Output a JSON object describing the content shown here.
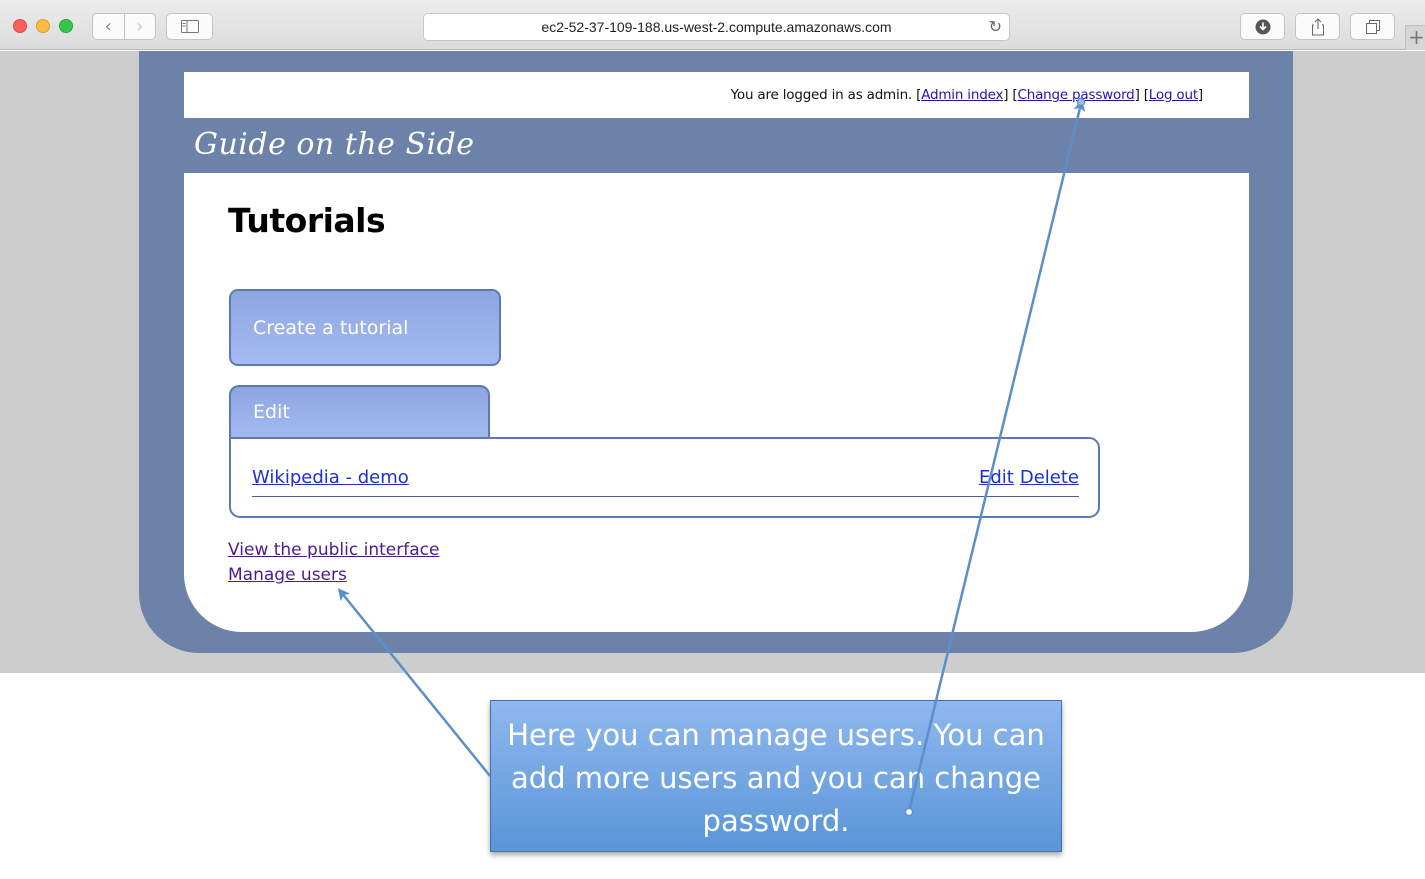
{
  "browser": {
    "url": "ec2-52-37-109-188.us-west-2.compute.amazonaws.com",
    "new_tab": "+"
  },
  "header": {
    "login_text": "You are logged in as admin.",
    "admin_index": "Admin index",
    "change_password": "Change password",
    "log_out": "Log out",
    "site_title": "Guide on the Side"
  },
  "main": {
    "title": "Tutorials",
    "create_button": "Create a tutorial",
    "edit_tab": "Edit",
    "tutorials": [
      {
        "name": "Wikipedia - demo",
        "edit": "Edit",
        "delete": "Delete"
      }
    ],
    "links": {
      "public_interface": "View the public interface",
      "manage_users": "Manage users"
    }
  },
  "callout": {
    "text": "Here you can manage users. You can add more users and you can change password."
  },
  "colors": {
    "frame": "#6d82a8",
    "button_fill": "#9bb1ea",
    "link_blue": "#1f2fd0",
    "link_visited": "#4d1a8f",
    "callout": "#6fa3e2",
    "arrow": "#5b8fc9"
  }
}
